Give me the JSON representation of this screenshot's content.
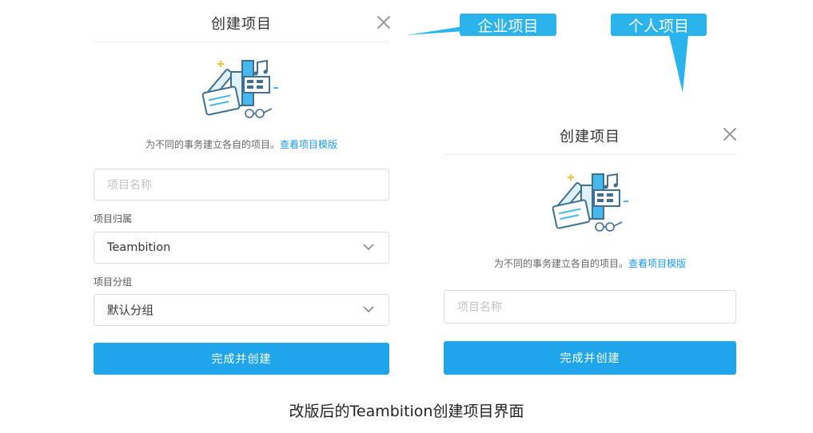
{
  "left_dialog": {
    "title": "创建项目",
    "description": "为不同的事务建立各自的项目。",
    "template_link": "查看项目模版",
    "name_placeholder": "项目名称",
    "owner_label": "项目归属",
    "owner_value": "Teambition",
    "group_label": "项目分组",
    "group_value": "默认分组",
    "submit_label": "完成并创建"
  },
  "right_dialog": {
    "title": "创建项目",
    "description": "为不同的事务建立各自的项目。",
    "template_link": "查看项目模版",
    "name_placeholder": "项目名称",
    "submit_label": "完成并创建"
  },
  "callouts": {
    "enterprise": "企业项目",
    "personal": "个人项目"
  },
  "caption": "改版后的Teambition创建项目界面",
  "colors": {
    "accent": "#1fa5ea",
    "link": "#1b9aee",
    "callout": "#2bb3ec"
  },
  "icons": [
    "close-icon",
    "project-illustration",
    "chevron-down-icon"
  ]
}
